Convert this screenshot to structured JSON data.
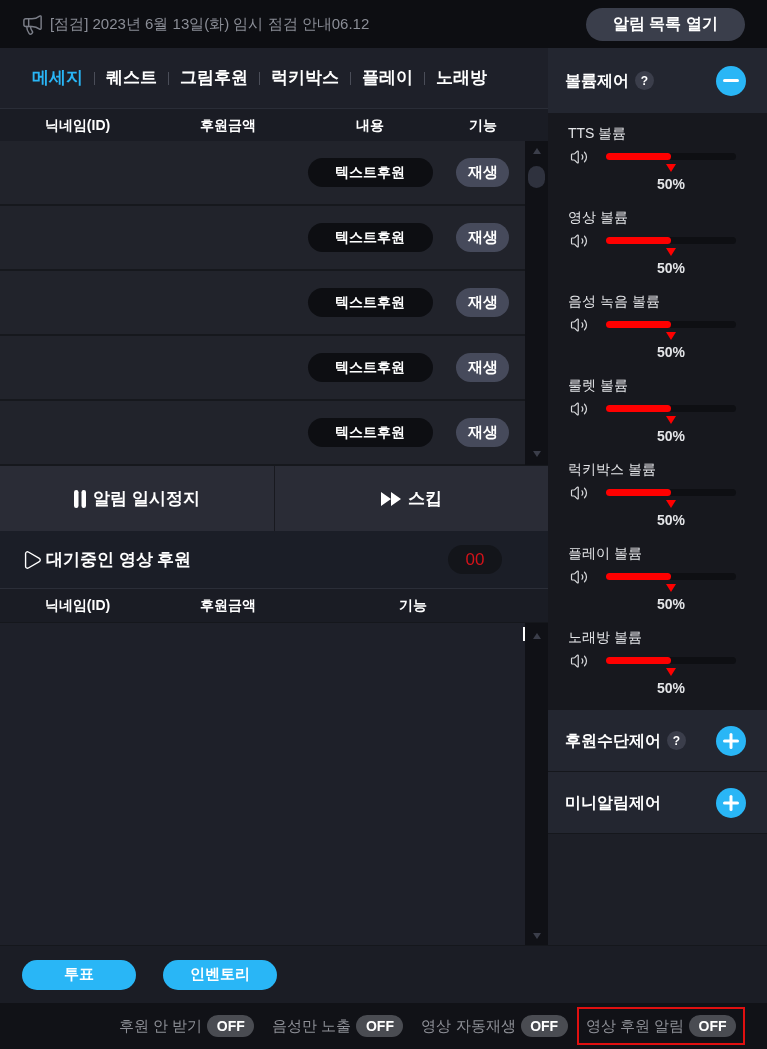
{
  "notice_bar": {
    "text": "[점검] 2023년 6월 13일(화) 임시 점검 안내06.12",
    "button": "알림 목록 열기"
  },
  "tabs": [
    {
      "label": "메세지",
      "selected": true
    },
    {
      "label": "퀘스트",
      "selected": false
    },
    {
      "label": "그림후원",
      "selected": false
    },
    {
      "label": "럭키박스",
      "selected": false
    },
    {
      "label": "플레이",
      "selected": false
    },
    {
      "label": "노래방",
      "selected": false
    }
  ],
  "donation_table": {
    "columns": [
      "닉네임(ID)",
      "후원금액",
      "내용",
      "기능"
    ],
    "rows": [
      {
        "type": "텍스트후원",
        "action": "재생"
      },
      {
        "type": "텍스트후원",
        "action": "재생"
      },
      {
        "type": "텍스트후원",
        "action": "재생"
      },
      {
        "type": "텍스트후원",
        "action": "재생"
      },
      {
        "type": "텍스트후원",
        "action": "재생"
      }
    ]
  },
  "controls": [
    {
      "kind": "pause",
      "label": "알림 일시정지"
    },
    {
      "kind": "skip",
      "label": "스킵"
    }
  ],
  "video_queue": {
    "title": "대기중인 영상 후원",
    "count": "00",
    "columns": [
      "닉네임(ID)",
      "후원금액",
      "기능"
    ]
  },
  "volume_panel": {
    "title": "볼륨제어",
    "help": "?",
    "expanded": true,
    "channels": [
      {
        "name": "TTS 볼륨",
        "level": 0.5,
        "reading": "50%"
      },
      {
        "name": "영상 볼륨",
        "level": 0.5,
        "reading": "50%"
      },
      {
        "name": "음성 녹음 볼륨",
        "level": 0.5,
        "reading": "50%"
      },
      {
        "name": "룰렛 볼륨",
        "level": 0.5,
        "reading": "50%"
      },
      {
        "name": "럭키박스 볼륨",
        "level": 0.5,
        "reading": "50%"
      },
      {
        "name": "플레이 볼륨",
        "level": 0.5,
        "reading": "50%"
      },
      {
        "name": "노래방 볼륨",
        "level": 0.5,
        "reading": "50%"
      }
    ]
  },
  "sections": [
    {
      "title": "후원수단제어",
      "help": "?",
      "expanded": false
    },
    {
      "title": "미니알림제어",
      "expanded": false
    }
  ],
  "bottom_buttons": [
    "투표",
    "인벤토리"
  ],
  "status_toggles": [
    {
      "label": "후원 안 받기",
      "on": false,
      "state": "OFF",
      "highlighted": false
    },
    {
      "label": "음성만 노출",
      "on": false,
      "state": "OFF",
      "highlighted": false
    },
    {
      "label": "영상 자동재생",
      "on": false,
      "state": "OFF",
      "highlighted": false
    },
    {
      "label": "영상 후원 알림",
      "on": false,
      "state": "OFF",
      "highlighted": true
    }
  ]
}
